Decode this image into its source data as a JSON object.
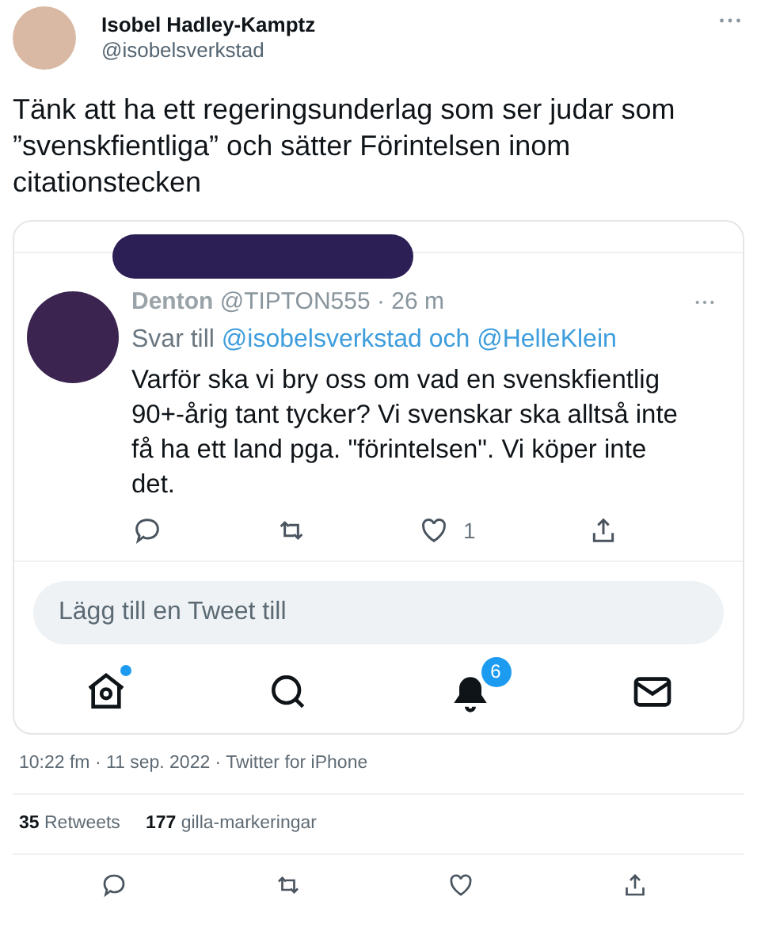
{
  "author": {
    "name": "Isobel Hadley-Kamptz",
    "handle": "@isobelsverkstad"
  },
  "tweet_text": "Tänk att ha ett regeringsunderlag som ser judar som ”svenskfientliga” och sätter Förintelsen inom citationstecken",
  "embedded_screenshot": {
    "name": "Denton",
    "handle": "@TIPTON555",
    "time": "· 26 m",
    "reply_prefix": "Svar till",
    "reply_to": "@isobelsverkstad och @HelleKlein",
    "text": "Varför ska vi bry oss om vad en svenskfientlig 90+-årig tant tycker? Vi svenskar ska alltså inte få ha ett land pga. \"förintelsen\". Vi köper inte det.",
    "actions": [
      {
        "kind": "reply"
      },
      {
        "kind": "retweet"
      },
      {
        "kind": "like",
        "count": "1"
      },
      {
        "kind": "share"
      }
    ],
    "compose_placeholder": "Lägg till en Tweet till",
    "nav": [
      {
        "kind": "home",
        "dot": true
      },
      {
        "kind": "search"
      },
      {
        "kind": "notifications",
        "badge": "6"
      },
      {
        "kind": "messages"
      }
    ]
  },
  "timestamp": "10:22 fm · 11 sep. 2022 · Twitter for iPhone",
  "stats": [
    {
      "count": "35",
      "label": "Retweets"
    },
    {
      "count": "177",
      "label": "gilla-markeringar"
    }
  ],
  "actions": [
    {
      "kind": "reply"
    },
    {
      "kind": "retweet"
    },
    {
      "kind": "like"
    },
    {
      "kind": "share"
    }
  ]
}
